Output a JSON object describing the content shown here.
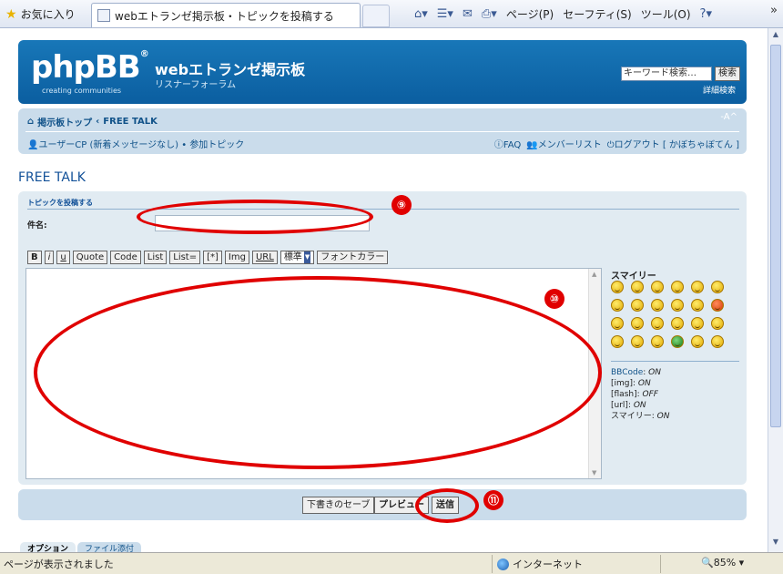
{
  "browser": {
    "favorites_label": "お気に入り",
    "tab_title": "webエトランゼ掲示板・トピックを投稿する",
    "page_menu": "ページ(P)",
    "safety_menu": "セーフティ(S)",
    "tools_menu": "ツール(O)",
    "more": "»"
  },
  "header": {
    "logo_text": "phpBB",
    "logo_reg": "®",
    "logo_sub": "creating communities",
    "site_title": "webエトランゼ掲示板",
    "site_desc": "リスナーフォーラム",
    "search_placeholder": "キーワード検索…",
    "search_button": "検索",
    "advanced_search": "詳細検索"
  },
  "nav": {
    "board_index": "掲示板トップ",
    "separator": "‹",
    "forum": "FREE TALK",
    "font_size": "-A^",
    "ucp": "ユーザーCP (新着メッセージなし) • 参加トピック",
    "faq": "FAQ",
    "members": "メンバーリスト",
    "logout": "ログアウト [ かぼちゃぼてん ]"
  },
  "page_title": "FREE TALK",
  "post": {
    "heading": "トピックを投稿する",
    "subject_label": "件名:",
    "subject_value": "",
    "bbcode_buttons": [
      "B",
      "i",
      "u",
      "Quote",
      "Code",
      "List",
      "List=",
      "[*]",
      "Img",
      "URL"
    ],
    "size_select": "標準",
    "font_color": "フォントカラー",
    "smilies_title": "スマイリー",
    "status": [
      {
        "k": "BBCode",
        "v": "ON"
      },
      {
        "k": "[img]",
        "v": "ON"
      },
      {
        "k": "[flash]",
        "v": "OFF"
      },
      {
        "k": "[url]",
        "v": "ON"
      },
      {
        "k": "スマイリー",
        "v": "ON"
      }
    ]
  },
  "submit": {
    "save_draft": "下書きのセーブ",
    "preview": "プレビュー",
    "submit": "送信"
  },
  "bottom_tabs": [
    "オプション",
    "ファイル添付"
  ],
  "annotations": [
    "⑨",
    "⑩",
    "⑪"
  ],
  "annotation_color": "#e00000",
  "statusbar": {
    "text": "ページが表示されました",
    "zone": "インターネット",
    "zoom": "85%"
  }
}
